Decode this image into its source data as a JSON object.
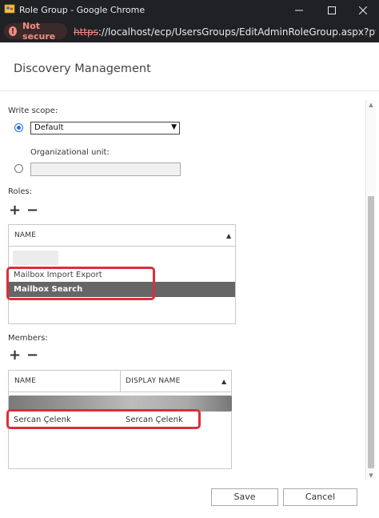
{
  "window": {
    "title": "Role Group - Google Chrome",
    "security_label": "Not secure",
    "url_scheme": "https",
    "url_rest": "://localhost/ecp/UsersGroups/EditAdminRoleGroup.aspx?pw..."
  },
  "dialog": {
    "title": "Discovery Management",
    "write_scope": {
      "label": "Write scope:",
      "selected_option": "Default",
      "default_checked": true
    },
    "organizational_unit": {
      "label": "Organizational unit:",
      "value": ""
    },
    "roles": {
      "label": "Roles:",
      "add_symbol": "+",
      "remove_symbol": "−",
      "column_header": "NAME",
      "items": [
        {
          "name": "Mailbox Import Export",
          "selected": false
        },
        {
          "name": "Mailbox Search",
          "selected": true
        }
      ]
    },
    "members": {
      "label": "Members:",
      "add_symbol": "+",
      "remove_symbol": "−",
      "columns": [
        "NAME",
        "DISPLAY NAME"
      ],
      "rows": [
        {
          "name": "Sercan Çelenk",
          "display_name": "Sercan Çelenk"
        }
      ]
    },
    "save_label": "Save",
    "cancel_label": "Cancel"
  },
  "colors": {
    "highlight": "#d9303b",
    "selected_row": "#666666",
    "radio": "#1a73e8"
  },
  "icons": {
    "app": "role-group-icon",
    "sort": "sort-up-icon",
    "dropdown": "chevron-down-icon"
  }
}
